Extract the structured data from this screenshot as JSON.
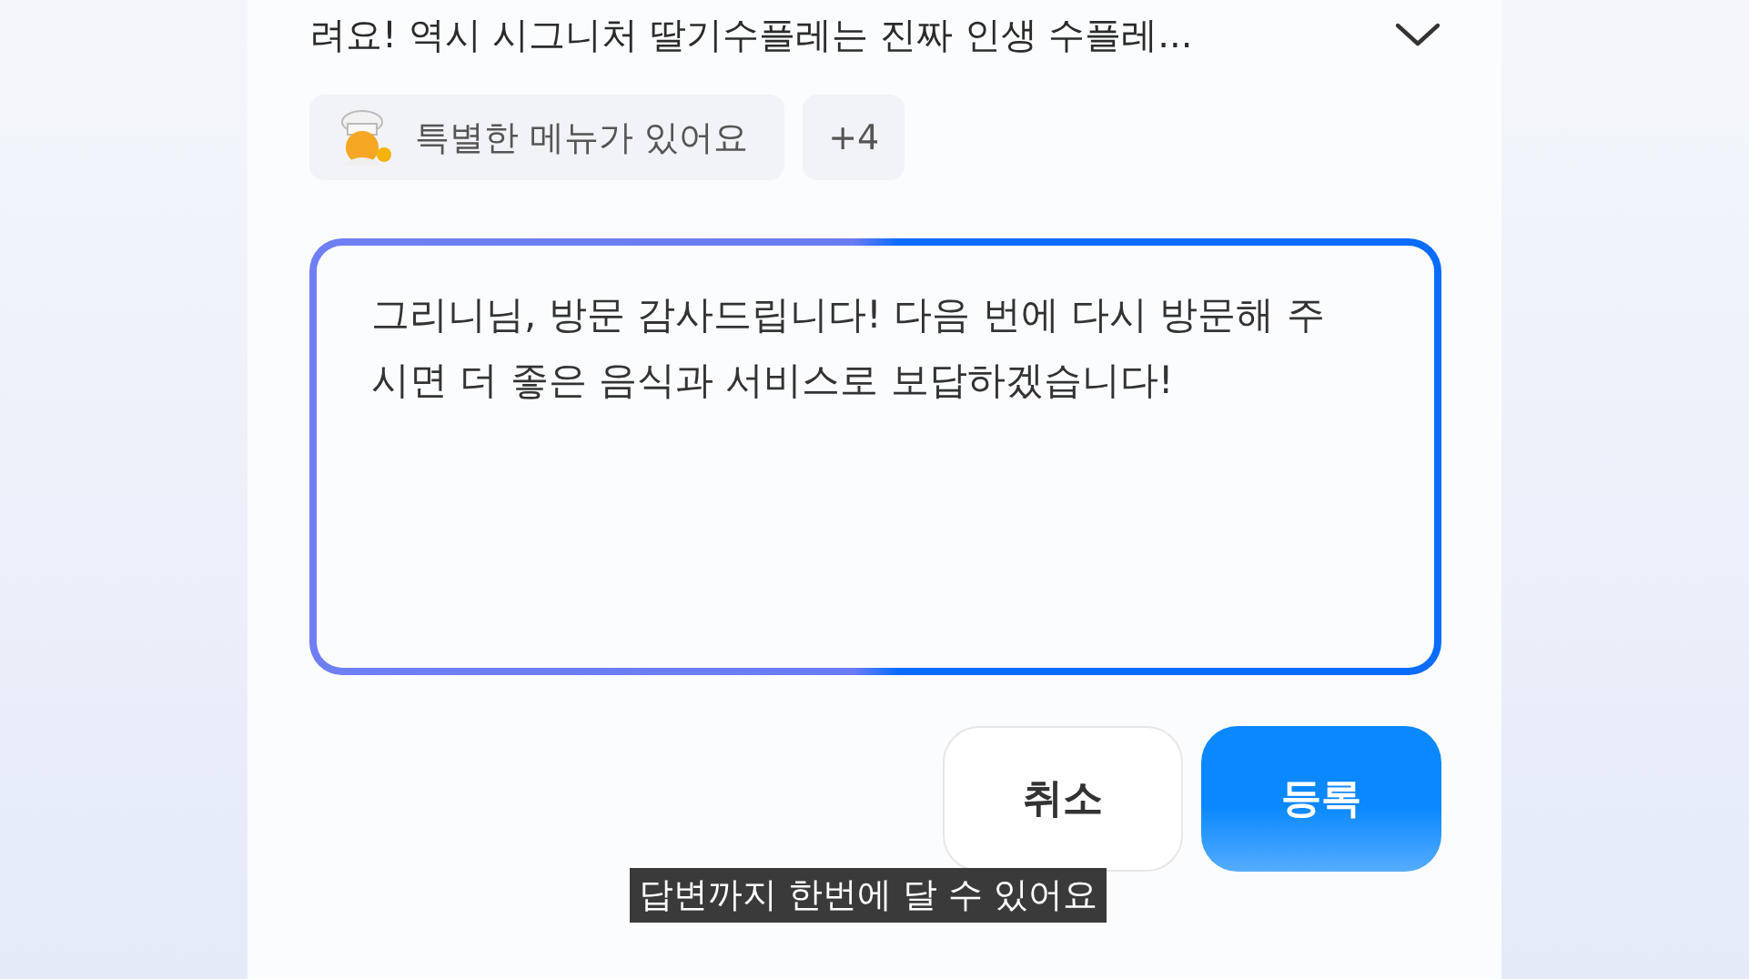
{
  "review": {
    "text": "려요! 역시 시그니처 딸기수플레는 진짜 인생 수플레...",
    "expanded": false
  },
  "tags": [
    {
      "kind": "icon",
      "label": "특별한 메뉴가 있어요"
    },
    {
      "kind": "more",
      "label": "+4"
    }
  ],
  "reply": {
    "value": "그리니님, 방문 감사드립니다! 다음 번에 다시 방문해 주시면 더 좋은 음식과 서비스로 보답하겠습니다!"
  },
  "buttons": [
    {
      "kind": "secondary",
      "label": "취소"
    },
    {
      "kind": "primary",
      "label": "등록"
    }
  ],
  "subtitle": "답변까지 한번에 달 수 있어요"
}
